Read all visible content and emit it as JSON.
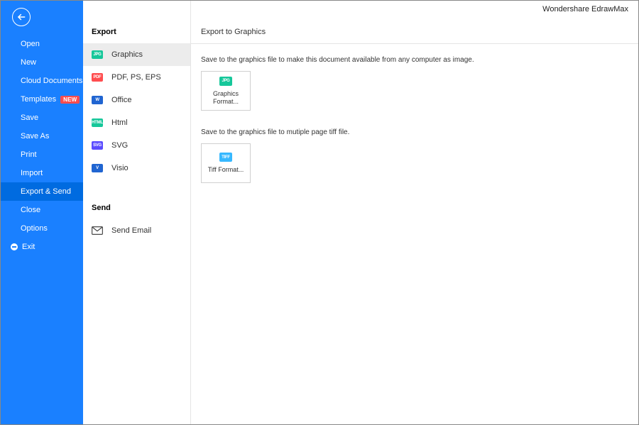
{
  "app_title": "Wondershare EdrawMax",
  "sidebar": {
    "open": "Open",
    "new": "New",
    "cloud_documents": "Cloud Documents",
    "templates": "Templates",
    "templates_badge": "NEW",
    "save": "Save",
    "save_as": "Save As",
    "print": "Print",
    "import": "Import",
    "export_send": "Export & Send",
    "close": "Close",
    "options": "Options",
    "exit": "Exit"
  },
  "col2": {
    "export_header": "Export",
    "graphics": "Graphics",
    "pdf_ps_eps": "PDF, PS, EPS",
    "office": "Office",
    "html": "Html",
    "svg": "SVG",
    "visio": "Visio",
    "send_header": "Send",
    "send_email": "Send Email",
    "icons": {
      "jpg": "JPG",
      "pdf": "PDF",
      "off": "W",
      "html": "HTML",
      "svg": "SVG",
      "vis": "V"
    }
  },
  "main": {
    "header": "Export to Graphics",
    "desc1": "Save to the graphics file to make this document available from any computer as image.",
    "tile1_label": "Graphics Format...",
    "tile1_icon": "JPG",
    "desc2": "Save to the graphics file to mutiple page tiff file.",
    "tile2_label": "Tiff Format...",
    "tile2_icon": "TIFF"
  }
}
